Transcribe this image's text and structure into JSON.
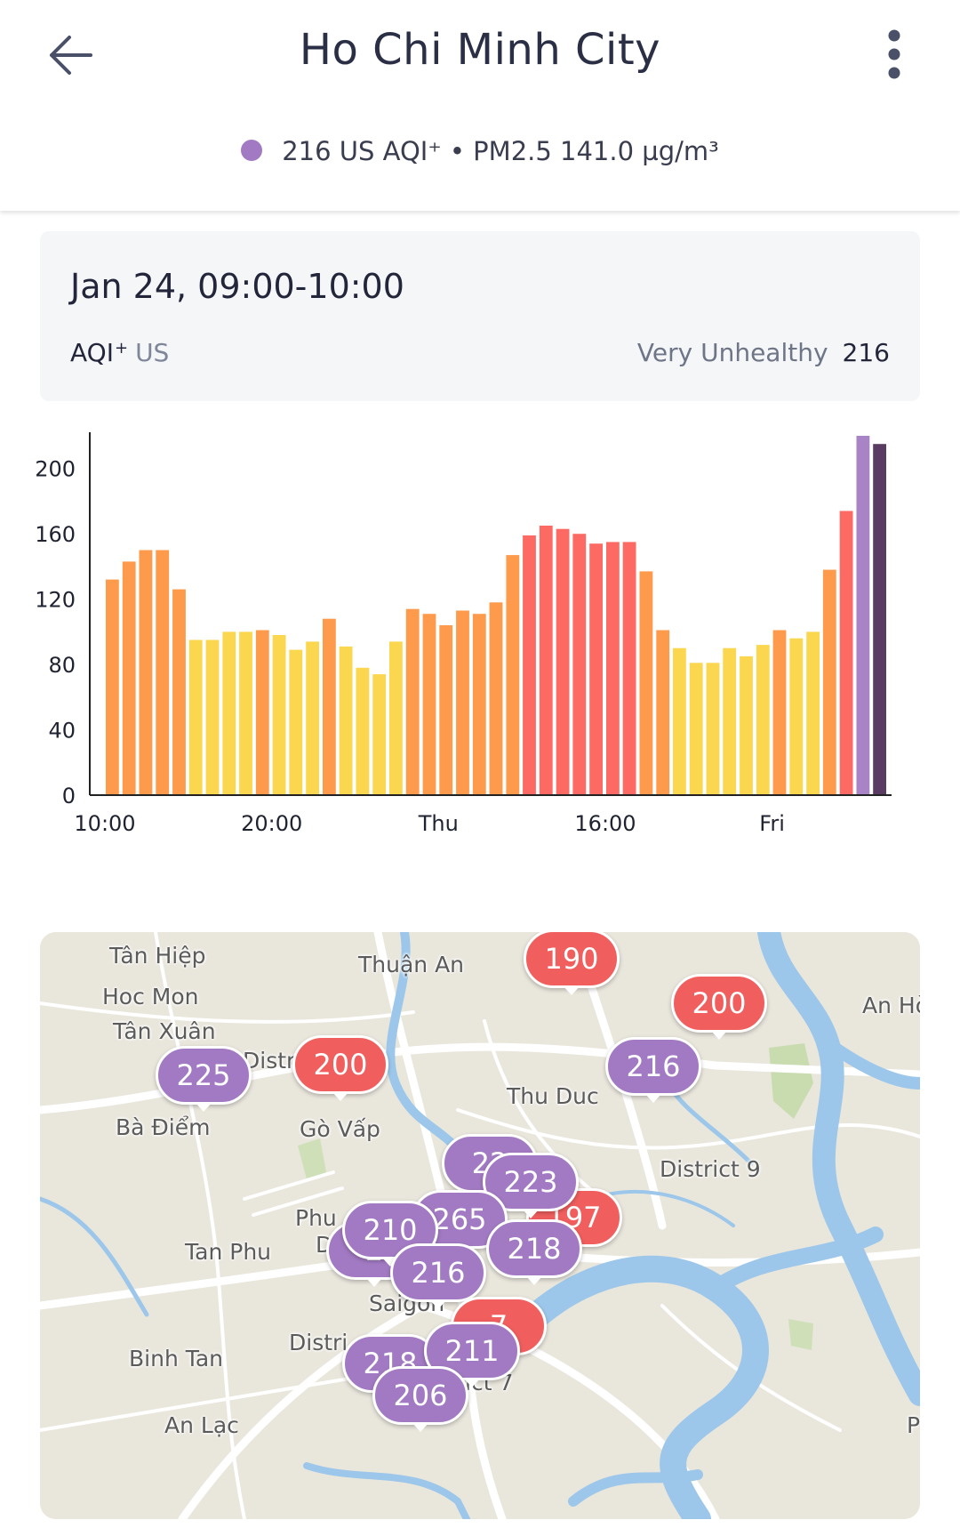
{
  "header": {
    "title": "Ho Chi Minh City",
    "back_icon": "arrow-left-icon",
    "menu_icon": "more-vertical-icon",
    "summary": "216 US AQI⁺ • PM2.5 141.0 µg/m³",
    "summary_dot_color": "#a27ac3"
  },
  "info": {
    "date_range": "Jan 24, 09:00-10:00",
    "label": "AQI",
    "label_sup": "+",
    "unit": "US",
    "status": "Very Unhealthy",
    "value": "216"
  },
  "chart_data": {
    "type": "bar",
    "y_ticks": [
      "0",
      "40",
      "80",
      "120",
      "160",
      "200"
    ],
    "ylim": [
      0,
      220
    ],
    "x_tick_labels": [
      {
        "label": "10:00",
        "index": 0
      },
      {
        "label": "20:00",
        "index": 10
      },
      {
        "label": "Thu",
        "index": 20
      },
      {
        "label": "16:00",
        "index": 30
      },
      {
        "label": "Fri",
        "index": 40
      }
    ],
    "values": [
      132,
      143,
      150,
      150,
      126,
      95,
      95,
      100,
      100,
      101,
      98,
      89,
      94,
      108,
      91,
      78,
      74,
      94,
      114,
      111,
      104,
      113,
      111,
      118,
      147,
      159,
      165,
      163,
      160,
      154,
      155,
      155,
      137,
      101,
      90,
      81,
      81,
      90,
      85,
      92,
      101,
      96,
      100,
      138,
      174,
      220,
      215
    ],
    "colors": {
      "moderate": "#fbd64f",
      "unhealthy_sensitive": "#fd9a4b",
      "unhealthy": "#fd6a63",
      "very_unhealthy": "#a884c7",
      "current": "#5a3c63"
    }
  },
  "map": {
    "places": [
      "Tân Hiệp",
      "Thuận An",
      "Hoc Mon",
      "Tân Xuân",
      "An Hò",
      "Thu Duc",
      "Bà Điểm",
      "Gò Vấp",
      "District 9",
      "Distr",
      "Phu",
      "D",
      "Tan Phu",
      "Saigon",
      "Binh Tan",
      "Distri",
      "ict 7",
      "An Lạc",
      "P"
    ],
    "markers": [
      {
        "value": "190",
        "color": "red"
      },
      {
        "value": "200",
        "color": "red"
      },
      {
        "value": "216",
        "color": "purple"
      },
      {
        "value": "225",
        "color": "purple"
      },
      {
        "value": "200",
        "color": "red"
      },
      {
        "value": "197",
        "color": "red"
      },
      {
        "value": "22",
        "color": "purple"
      },
      {
        "value": "223",
        "color": "purple"
      },
      {
        "value": "265",
        "color": "purple"
      },
      {
        "value": "2",
        "color": "purple"
      },
      {
        "value": "210",
        "color": "purple"
      },
      {
        "value": "218",
        "color": "purple"
      },
      {
        "value": "216",
        "color": "purple"
      },
      {
        "value": "7",
        "color": "red"
      },
      {
        "value": "218",
        "color": "purple"
      },
      {
        "value": "211",
        "color": "purple"
      },
      {
        "value": "206",
        "color": "purple"
      }
    ]
  }
}
